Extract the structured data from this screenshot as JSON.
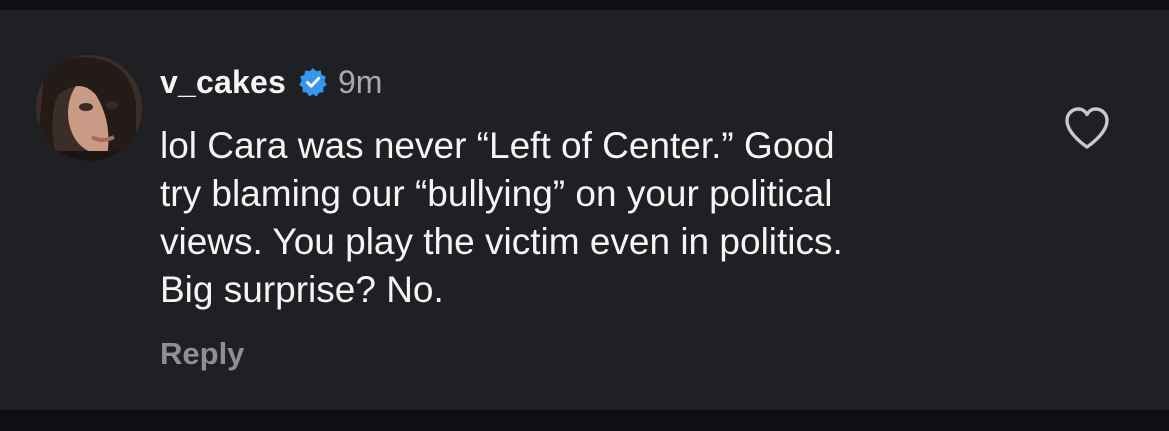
{
  "comment": {
    "username": "v_cakes",
    "timestamp": "9m",
    "verified": true,
    "text": "lol Cara was never “Left of Center.” Good\ntry blaming our “bullying” on your political\nviews.  You play the victim even in politics.\nBig surprise?  No.",
    "reply_label": "Reply"
  },
  "icons": {
    "verified": "verified-badge-icon",
    "like": "heart-outline-icon"
  },
  "colors": {
    "background": "#1f2024",
    "text": "#f5f5f5",
    "muted": "#a8a9ad",
    "verified": "#3797f0"
  }
}
